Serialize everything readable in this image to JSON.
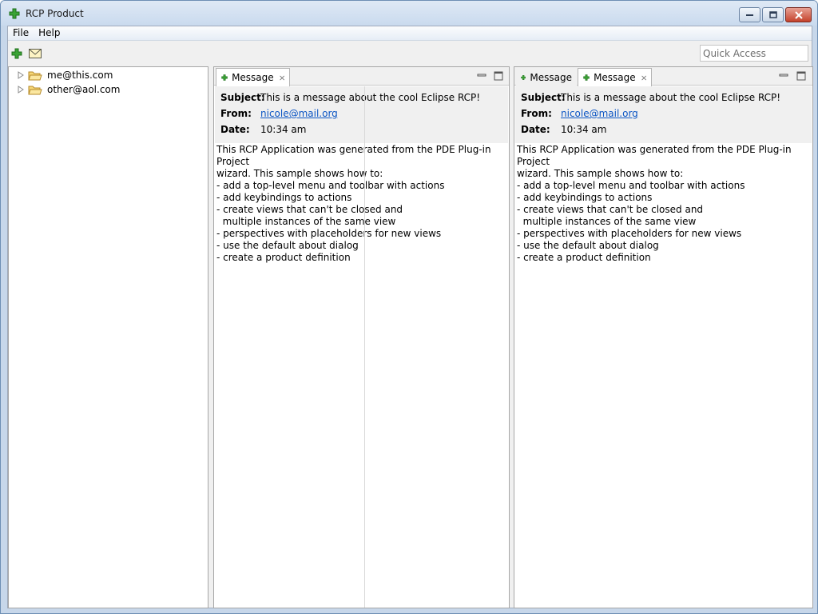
{
  "window": {
    "title": "RCP Product"
  },
  "menubar": {
    "items": [
      "File",
      "Help"
    ]
  },
  "toolbar": {
    "quick_access_placeholder": "Quick Access"
  },
  "navigator": {
    "items": [
      {
        "label": "me@this.com"
      },
      {
        "label": "other@aol.com"
      }
    ]
  },
  "left_stack": {
    "tabs": [
      {
        "label": "Message",
        "active": true
      }
    ]
  },
  "right_stack": {
    "tabs": [
      {
        "label": "Message",
        "active": false
      },
      {
        "label": "Message",
        "active": true
      }
    ]
  },
  "message": {
    "subject_label": "Subject:",
    "subject": "This is a message about the cool Eclipse RCP!",
    "from_label": "From:",
    "from": "nicole@mail.org",
    "date_label": "Date:",
    "date": "10:34 am",
    "body": "This RCP Application was generated from the PDE Plug-in Project\nwizard. This sample shows how to:\n- add a top-level menu and toolbar with actions\n- add keybindings to actions\n- create views that can't be closed and\n  multiple instances of the same view\n- perspectives with placeholders for new views\n- use the default about dialog\n- create a product definition"
  },
  "colors": {
    "title_bar": "#c9daee",
    "close_button": "#c4422c",
    "link": "#0b55c4",
    "icon_green": "#3aa335"
  }
}
